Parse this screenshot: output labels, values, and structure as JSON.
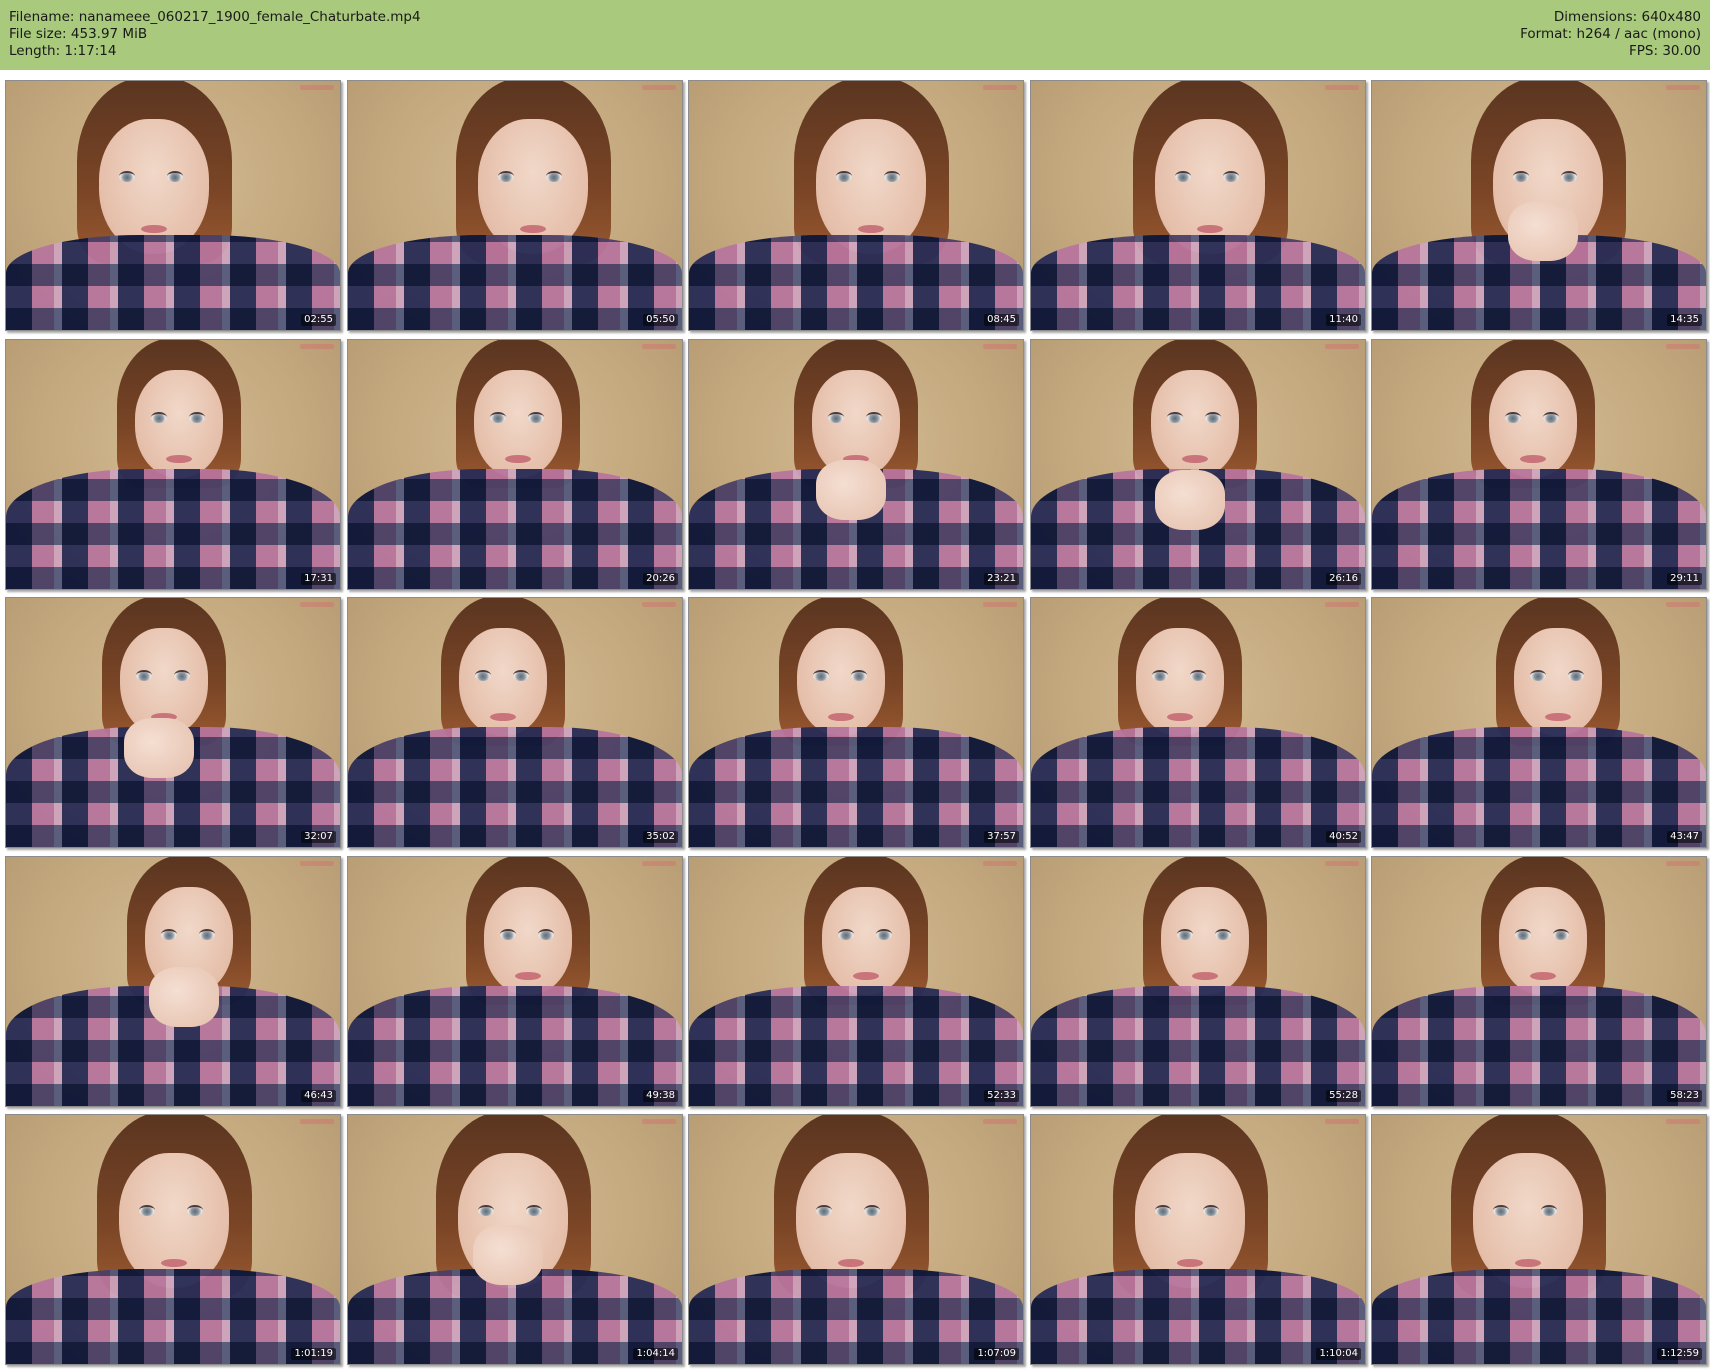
{
  "header": {
    "filename": "Filename: nanameee_060217_1900_female_Chaturbate.mp4",
    "filesize": "File size: 453.97 MiB",
    "length": "Length: 1:17:14",
    "dimensions": "Dimensions: 640x480",
    "format": "Format: h264 / aac (mono)",
    "fps": "FPS: 30.00"
  },
  "colors": {
    "header_bg": "#a9c97c",
    "background": "#ffffff",
    "wall": "#c7ad86"
  },
  "thumbnails": [
    {
      "time": "02:55"
    },
    {
      "time": "05:50"
    },
    {
      "time": "08:45"
    },
    {
      "time": "11:40"
    },
    {
      "time": "14:35"
    },
    {
      "time": "17:31"
    },
    {
      "time": "20:26"
    },
    {
      "time": "23:21"
    },
    {
      "time": "26:16"
    },
    {
      "time": "29:11"
    },
    {
      "time": "32:07"
    },
    {
      "time": "35:02"
    },
    {
      "time": "37:57"
    },
    {
      "time": "40:52"
    },
    {
      "time": "43:47"
    },
    {
      "time": "46:43"
    },
    {
      "time": "49:38"
    },
    {
      "time": "52:33"
    },
    {
      "time": "55:28"
    },
    {
      "time": "58:23"
    },
    {
      "time": "1:01:19"
    },
    {
      "time": "1:04:14"
    },
    {
      "time": "1:07:09"
    },
    {
      "time": "1:10:04"
    },
    {
      "time": "1:12:59"
    }
  ]
}
